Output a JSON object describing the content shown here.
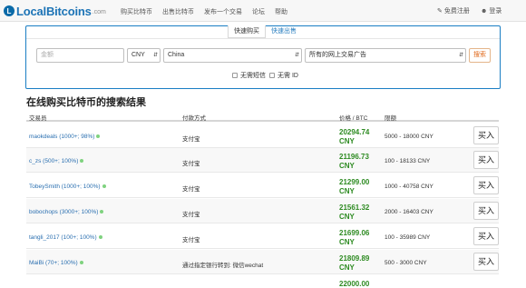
{
  "navbar": {
    "brand_logo_letter": "L",
    "brand_name": "LocalBitcoins",
    "brand_suffix": ".com",
    "links": [
      "购买比特币",
      "出售比特币",
      "发布一个交易",
      "论坛",
      "帮助"
    ],
    "signup": "免费注册",
    "login": "登录"
  },
  "search": {
    "tabs": {
      "buy": "快速购买",
      "sell": "快速出售"
    },
    "amount_placeholder": "金额",
    "currency": "CNY",
    "country": "China",
    "payment_method": "所有的网上交易广告",
    "search_button": "搜索",
    "checkbox_sms": "无需短信",
    "checkbox_id": "无需 ID"
  },
  "results": {
    "title": "在线购买比特币的搜索结果",
    "columns": {
      "trader": "交易员",
      "payment": "付款方式",
      "price": "价格 / BTC",
      "limits": "限额"
    },
    "buy_label": "买入",
    "rows": [
      {
        "trader": "maokdeals (1000+; 98%)",
        "payment": "支付宝",
        "price": "20294.74",
        "currency": "CNY",
        "limits": "5000 - 18000 CNY"
      },
      {
        "trader": "c_zs (500+; 100%)",
        "payment": "支付宝",
        "price": "21196.73",
        "currency": "CNY",
        "limits": "100 - 18133 CNY"
      },
      {
        "trader": "TobeySmith (1000+; 100%)",
        "payment": "支付宝",
        "price": "21299.00",
        "currency": "CNY",
        "limits": "1000 - 40758 CNY"
      },
      {
        "trader": "bobochops (3000+; 100%)",
        "payment": "支付宝",
        "price": "21561.32",
        "currency": "CNY",
        "limits": "2000 - 16403 CNY"
      },
      {
        "trader": "tangli_2017 (100+; 100%)",
        "payment": "支付宝",
        "price": "21699.06",
        "currency": "CNY",
        "limits": "100 - 35989 CNY"
      },
      {
        "trader": "MaiBi (70+; 100%)",
        "payment": "通过指定银行转到: 微信wechat",
        "price": "21809.89",
        "currency": "CNY",
        "limits": "500 - 3000 CNY"
      },
      {
        "trader": "",
        "payment": "",
        "price": "22000.00",
        "currency": "",
        "limits": ""
      }
    ]
  },
  "colors": {
    "accent": "#1a7ec4",
    "price_green": "#2e8b22",
    "link_blue": "#2a6fb0",
    "search_orange": "#e06a1d"
  }
}
